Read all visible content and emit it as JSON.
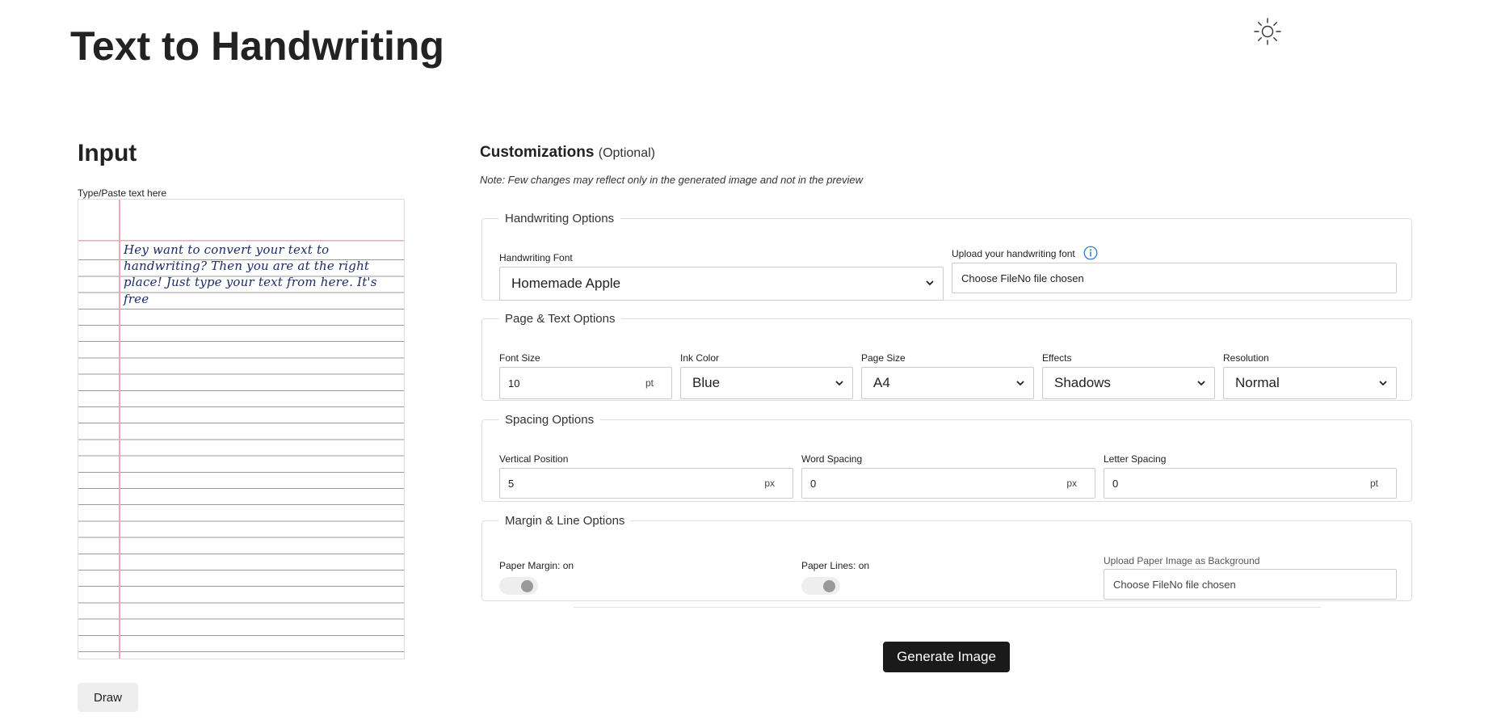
{
  "header": {
    "title": "Text to Handwriting",
    "theme_icon": "sun-icon"
  },
  "input": {
    "heading": "Input",
    "textarea_label": "Type/Paste text here",
    "paper_text": "Hey want to convert your text to handwriting? Then you are at the right place! Just type your text from here. It's free",
    "draw_label": "Draw"
  },
  "customizations": {
    "title": "Customizations",
    "optional": "(Optional)",
    "note": "Note: Few changes may reflect only in the generated image and not in the preview",
    "handwriting": {
      "legend": "Handwriting Options",
      "font_label": "Handwriting Font",
      "font_value": "Homemade Apple",
      "upload_label": "Upload your handwriting font",
      "upload_value": "Choose FileNo file chosen"
    },
    "page_text": {
      "legend": "Page & Text Options",
      "font_size_label": "Font Size",
      "font_size_value": "10",
      "font_size_unit": "pt",
      "ink_color_label": "Ink Color",
      "ink_color_value": "Blue",
      "page_size_label": "Page Size",
      "page_size_value": "A4",
      "effects_label": "Effects",
      "effects_value": "Shadows",
      "resolution_label": "Resolution",
      "resolution_value": "Normal"
    },
    "spacing": {
      "legend": "Spacing Options",
      "vertical_label": "Vertical Position",
      "vertical_value": "5",
      "vertical_unit": "px",
      "word_label": "Word Spacing",
      "word_value": "0",
      "word_unit": "px",
      "letter_label": "Letter Spacing",
      "letter_value": "0",
      "letter_unit": "pt"
    },
    "margin_line": {
      "legend": "Margin & Line Options",
      "paper_margin_label": "Paper Margin: on",
      "paper_lines_label": "Paper Lines: on",
      "upload_bg_label": "Upload Paper Image as Background",
      "upload_bg_value": "Choose FileNo file chosen"
    },
    "generate_label": "Generate Image"
  },
  "colors": {
    "ink": "#1c2a6b",
    "margin_line": "#f3a6b6",
    "button_dark": "#1a1a1a",
    "info_blue": "#1f6fd1"
  }
}
